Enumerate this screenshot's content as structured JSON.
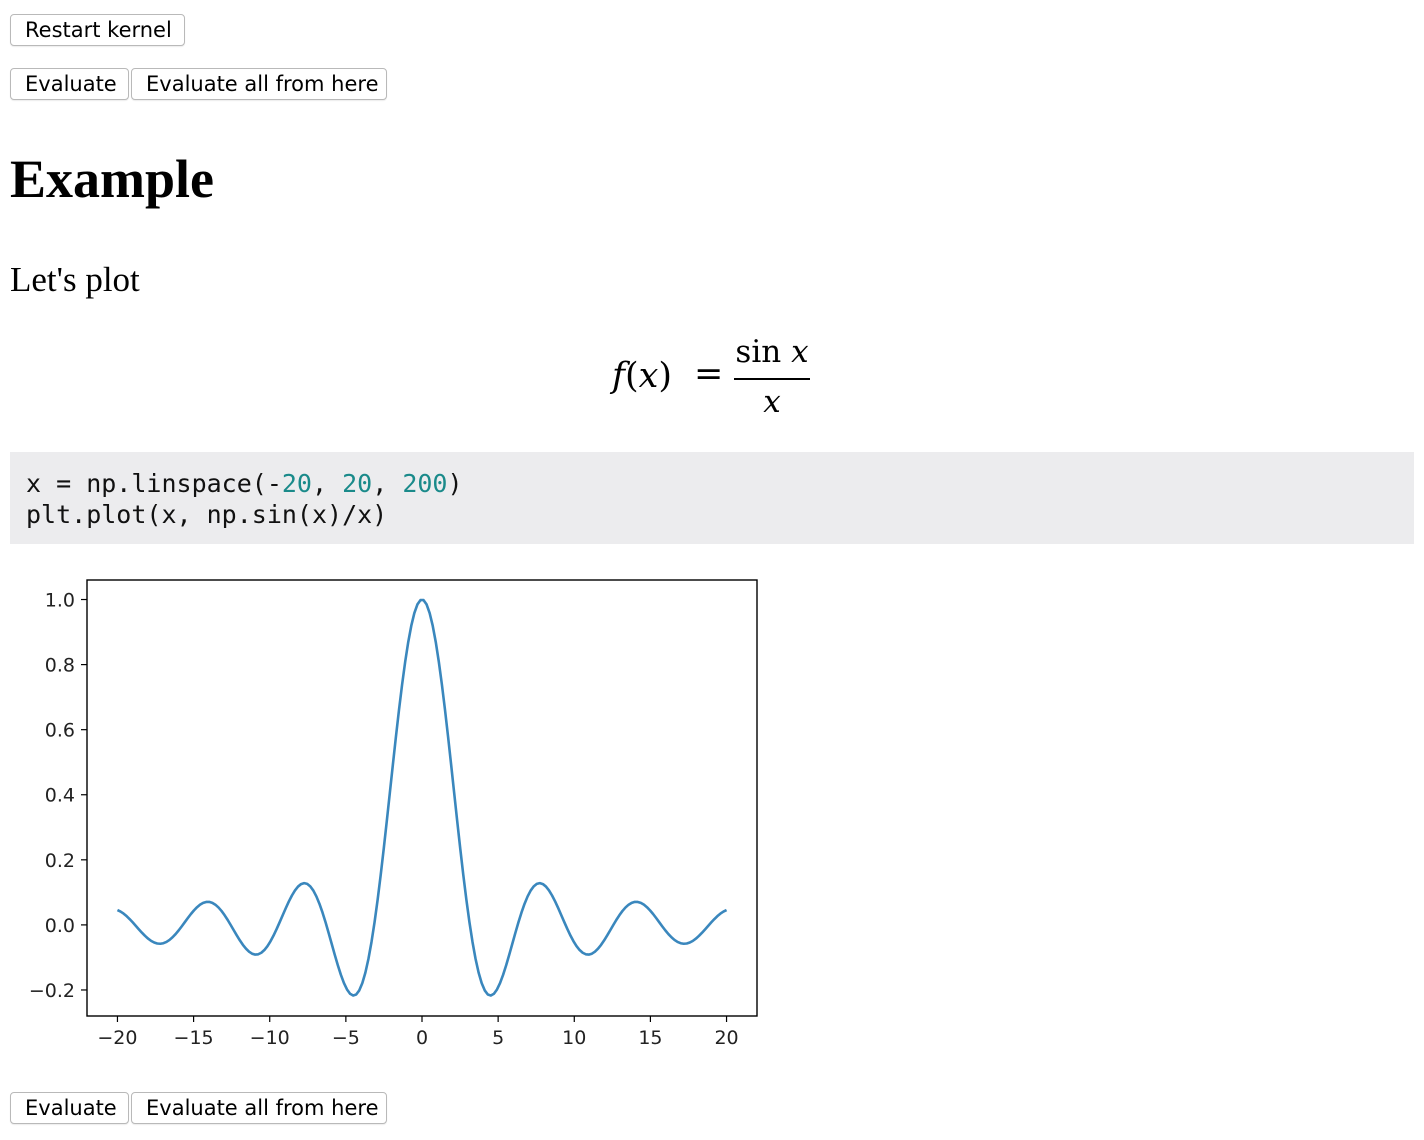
{
  "toolbar": {
    "restart_label": "Restart kernel"
  },
  "cell_top": {
    "evaluate_label": "Evaluate",
    "evaluate_all_label": "Evaluate all from here"
  },
  "cell_bottom": {
    "evaluate_label": "Evaluate",
    "evaluate_all_label": "Evaluate all from here"
  },
  "heading": "Example",
  "intro": "Let's plot",
  "formula": {
    "lhs_func": "f",
    "lhs_open": "(",
    "lhs_var": "x",
    "lhs_close": ")",
    "equals": "=",
    "numerator_fn": "sin",
    "numerator_var": "x",
    "denominator": "x"
  },
  "code": {
    "line1": [
      {
        "t": "x = np.linspace(-",
        "k": "plain"
      },
      {
        "t": "20",
        "k": "num"
      },
      {
        "t": ", ",
        "k": "plain"
      },
      {
        "t": "20",
        "k": "num"
      },
      {
        "t": ", ",
        "k": "plain"
      },
      {
        "t": "200",
        "k": "num"
      },
      {
        "t": ")",
        "k": "plain"
      }
    ],
    "line2": [
      {
        "t": "plt.plot(x, np.sin(x)/x)",
        "k": "plain"
      }
    ],
    "number_color": "#1a8a8a"
  },
  "chart_data": {
    "type": "line",
    "title": "",
    "xlabel": "",
    "ylabel": "",
    "function": "sin(x)/x",
    "x_range": [
      -20,
      20
    ],
    "num_points": 200,
    "xlim": [
      -22,
      22
    ],
    "ylim": [
      -0.28,
      1.06
    ],
    "xticks": [
      -20,
      -15,
      -10,
      -5,
      0,
      5,
      10,
      15,
      20
    ],
    "xtick_labels": [
      "−20",
      "−15",
      "−10",
      "−5",
      "0",
      "5",
      "10",
      "15",
      "20"
    ],
    "yticks": [
      -0.2,
      0.0,
      0.2,
      0.4,
      0.6,
      0.8,
      1.0
    ],
    "ytick_labels": [
      "−0.2",
      "0.0",
      "0.2",
      "0.4",
      "0.6",
      "0.8",
      "1.0"
    ],
    "series": [
      {
        "color": "#3a87bd",
        "x": [
          -20,
          -18,
          -16,
          -14,
          -12,
          -10,
          -8,
          -6,
          -4,
          -2,
          -1,
          0,
          1,
          2,
          4,
          6,
          8,
          10,
          12,
          14,
          16,
          18,
          20
        ],
        "y": [
          0.046,
          -0.042,
          0.018,
          0.071,
          0.045,
          -0.054,
          0.124,
          0.047,
          -0.189,
          0.455,
          0.841,
          1.0,
          0.841,
          0.455,
          -0.189,
          0.047,
          0.124,
          -0.054,
          0.045,
          0.071,
          0.018,
          -0.042,
          0.046
        ]
      }
    ],
    "grid": false
  }
}
